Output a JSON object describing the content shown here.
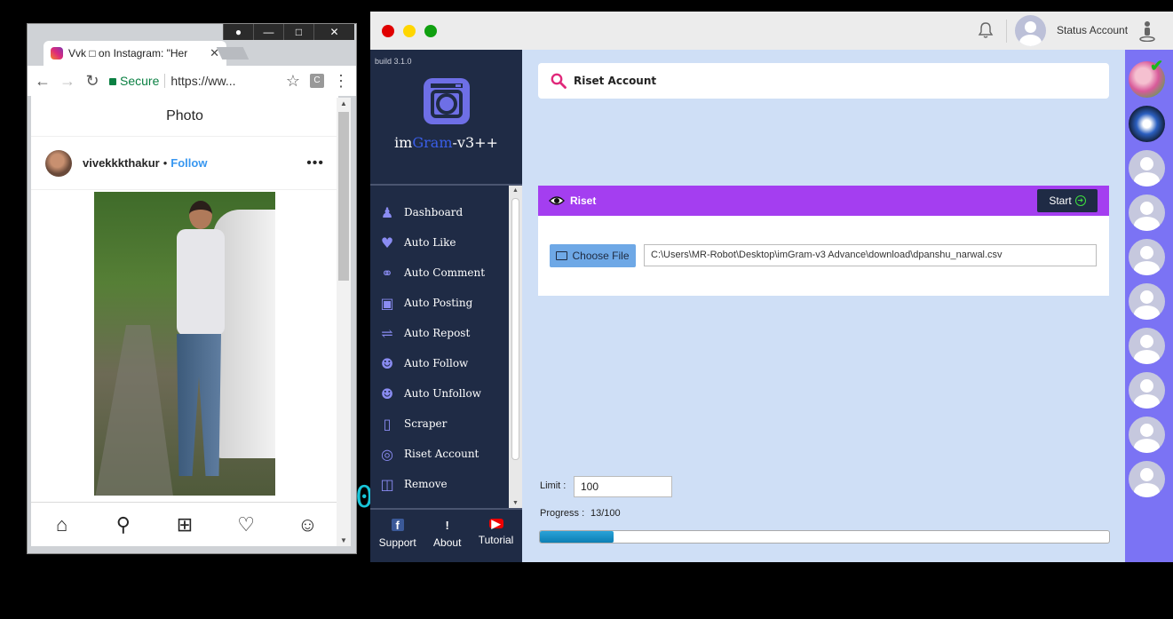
{
  "browser": {
    "tab_title": "Vvk □ on Instagram: \"Her",
    "secure_label": "Secure",
    "url": "https://ww...",
    "ext_label": "C",
    "page": {
      "header": "Photo",
      "username": "vivekkkthakur",
      "separator": "•",
      "follow_label": "Follow"
    }
  },
  "overlay_text": "0",
  "app": {
    "build": "build 3.1.0",
    "brand": {
      "prefix": "im",
      "highlight": "Gram",
      "suffix": "-v3++"
    },
    "status_account": "Status Account",
    "menu": [
      {
        "label": "Dashboard",
        "icon": "person-stand-icon"
      },
      {
        "label": "Auto Like",
        "icon": "heart-icon"
      },
      {
        "label": "Auto Comment",
        "icon": "comments-icon"
      },
      {
        "label": "Auto Posting",
        "icon": "image-icon"
      },
      {
        "label": "Auto Repost",
        "icon": "shuffle-icon"
      },
      {
        "label": "Auto Follow",
        "icon": "user-plus-icon"
      },
      {
        "label": "Auto Unfollow",
        "icon": "user-times-icon"
      },
      {
        "label": "Scraper",
        "icon": "code-file-icon"
      },
      {
        "label": "Riset Account",
        "icon": "target-icon"
      },
      {
        "label": "Remove",
        "icon": "trash-icon"
      }
    ],
    "footer": [
      {
        "label": "Support",
        "icon": "facebook-icon"
      },
      {
        "label": "About",
        "icon": "exclamation-icon"
      },
      {
        "label": "Tutorial",
        "icon": "youtube-icon"
      }
    ],
    "search_title": "Riset Account",
    "panel_title": "Riset",
    "start_label": "Start",
    "choose_file_label": "Choose File",
    "file_path": "C:\\Users\\MR-Robot\\Desktop\\imGram-v3 Advance\\download\\dpanshu_narwal.csv",
    "limit_label": "Limit :",
    "limit_value": "100",
    "progress_label": "Progress :",
    "progress_text": "13/100",
    "progress_fraction": 0.13,
    "accent_purple": "#a43ef0",
    "sidebar_bg": "#1f2b45",
    "accounts_bar": "#7b73f4"
  }
}
